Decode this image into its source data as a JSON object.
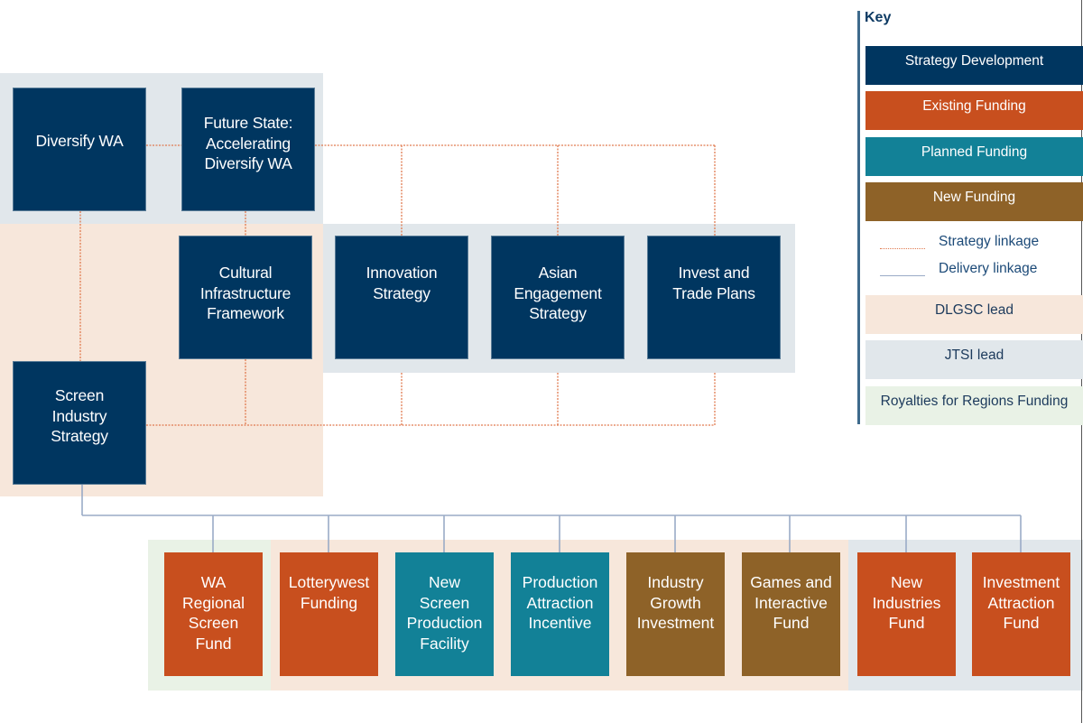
{
  "colors": {
    "strategy_development": "#003660",
    "existing_funding": "#c84f1e",
    "planned_funding": "#128197",
    "new_funding": "#8e6228",
    "strategy_linkage": "#e07a4f",
    "delivery_linkage": "#9aabc6",
    "dlgsc_lead": "#f7e7db",
    "jtsi_lead": "#e1e7eb",
    "royalties_for_regions": "#e9f2e6"
  },
  "strategies": {
    "diversify_wa": "Diversify WA",
    "future_state": "Future State:\nAccelerating\nDiversify WA",
    "cultural_infrastructure": "Cultural\nInfrastructure\nFramework",
    "innovation": "Innovation\nStrategy",
    "asian_engagement": "Asian\nEngagement\nStrategy",
    "invest_trade": "Invest and\nTrade Plans",
    "screen_industry": "Screen\nIndustry\nStrategy"
  },
  "funds": [
    {
      "label": "WA\nRegional\nScreen\nFund",
      "type": "existing_funding"
    },
    {
      "label": "Lotterywest\nFunding",
      "type": "existing_funding"
    },
    {
      "label": "New\nScreen\nProduction\nFacility",
      "type": "planned_funding"
    },
    {
      "label": "Production\nAttraction\nIncentive",
      "type": "planned_funding"
    },
    {
      "label": "Industry\nGrowth\nInvestment",
      "type": "new_funding"
    },
    {
      "label": "Games and\nInteractive\nFund",
      "type": "new_funding"
    },
    {
      "label": "New\nIndustries\nFund",
      "type": "existing_funding"
    },
    {
      "label": "Investment\nAttraction\nFund",
      "type": "existing_funding"
    }
  ],
  "key": {
    "title": "Key",
    "strategy_development": "Strategy Development",
    "existing_funding": "Existing Funding",
    "planned_funding": "Planned Funding",
    "new_funding": "New Funding",
    "strategy_linkage": "Strategy linkage",
    "delivery_linkage": "Delivery linkage",
    "dlgsc_lead": "DLGSC lead",
    "jtsi_lead": "JTSI lead",
    "royalties": "Royalties for Regions Funding"
  }
}
